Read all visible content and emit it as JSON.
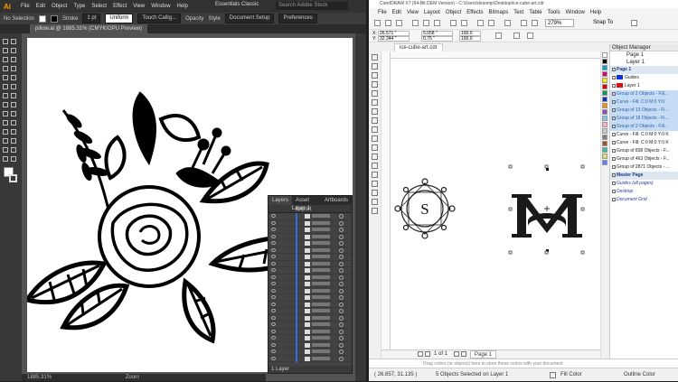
{
  "illustrator": {
    "app_logo": "Ai",
    "menu": [
      "File",
      "Edit",
      "Object",
      "Type",
      "Select",
      "Effect",
      "View",
      "Window",
      "Help"
    ],
    "workspace": "Essentials Classic",
    "search_placeholder": "Search Adobe Stock",
    "control_bar": {
      "selection": "No Selection",
      "stroke_label": "Stroke",
      "stroke_value": "1 pt",
      "uniform": "Uniform",
      "brush": "Touch Callig...",
      "opacity_label": "Opacity",
      "style_label": "Style",
      "doc_setup": "Document Setup",
      "preferences": "Preferences"
    },
    "doc_tab": "pillow.ai @ 1885.31% (CMYK/GPU Preview)",
    "status_zoom": "1885.31%",
    "status_tool": "Zoom",
    "layers_panel": {
      "tabs": [
        "Layers",
        "Asset Export",
        "Artboards"
      ],
      "layer_name": "Layer 1",
      "footer": "1 Layer"
    },
    "colors": {
      "accent": "#FF9A00",
      "selection_blue": "#2F6FDC",
      "canvas": "#FFFFFF"
    }
  },
  "coreldraw": {
    "title": "CorelDRAW X7 (64-Bit DEM Version) - C:\\Users\\desomp\\Desktop\\ice-cube-art.cdr",
    "menu": [
      "File",
      "Edit",
      "View",
      "Layout",
      "Object",
      "Effects",
      "Bitmaps",
      "Text",
      "Table",
      "Tools",
      "Window",
      "Help"
    ],
    "zoom": "279%",
    "snap_to": "Snap To",
    "props": {
      "x": "26.571 \"",
      "y": "32.344 \"",
      "w": "5.058 \"",
      "h": "0.75 \"",
      "sx": "100.0",
      "sy": "100.0"
    },
    "doc_tab": "ice-cube-art.cdr",
    "monogram_letter": "S",
    "page_nav": {
      "counter": "1 of 1",
      "page_tab": "Page 1"
    },
    "color_bar_hint": "Drag colors (or objects) here to store these colors with your document",
    "status": {
      "coords": "( 26.857, 31.135 )",
      "selection": "5 Objects Selected on Layer 1",
      "fill": "Fill Color",
      "outline": "Outline Color"
    },
    "object_manager": {
      "title": "Object Manager",
      "page": "Page 1",
      "layer": "Layer 1",
      "rows": [
        {
          "text": "Page 1",
          "style": "head"
        },
        {
          "text": "Guides",
          "style": "blue"
        },
        {
          "text": "Layer 1",
          "style": "red"
        },
        {
          "text": "Group of 2 Objects - Fill...",
          "style": "sel"
        },
        {
          "text": "Curve - Fill: C:0 M:0 Y:0",
          "style": "sel"
        },
        {
          "text": "Group of 13 Objects - Fi...",
          "style": "sel"
        },
        {
          "text": "Group of 18 Objects - Fi...",
          "style": "sel"
        },
        {
          "text": "Group of 2 Objects - Fill...",
          "style": "sel"
        },
        {
          "text": "Curve - Fill: C:0 M:0 Y:0 K",
          "style": "plain"
        },
        {
          "text": "Curve - Fill: C:0 M:0 Y:0 K",
          "style": "plain"
        },
        {
          "text": "Group of 838 Objects - F...",
          "style": "plain"
        },
        {
          "text": "Group of 463 Objects - F...",
          "style": "plain"
        },
        {
          "text": "Group of 2871 Objects - ...",
          "style": "plain"
        },
        {
          "text": "Master Page",
          "style": "head"
        },
        {
          "text": "Guides (all pages)",
          "style": "ital"
        },
        {
          "text": "Desktop",
          "style": "ital"
        },
        {
          "text": "Document Grid",
          "style": "ital"
        }
      ]
    }
  }
}
